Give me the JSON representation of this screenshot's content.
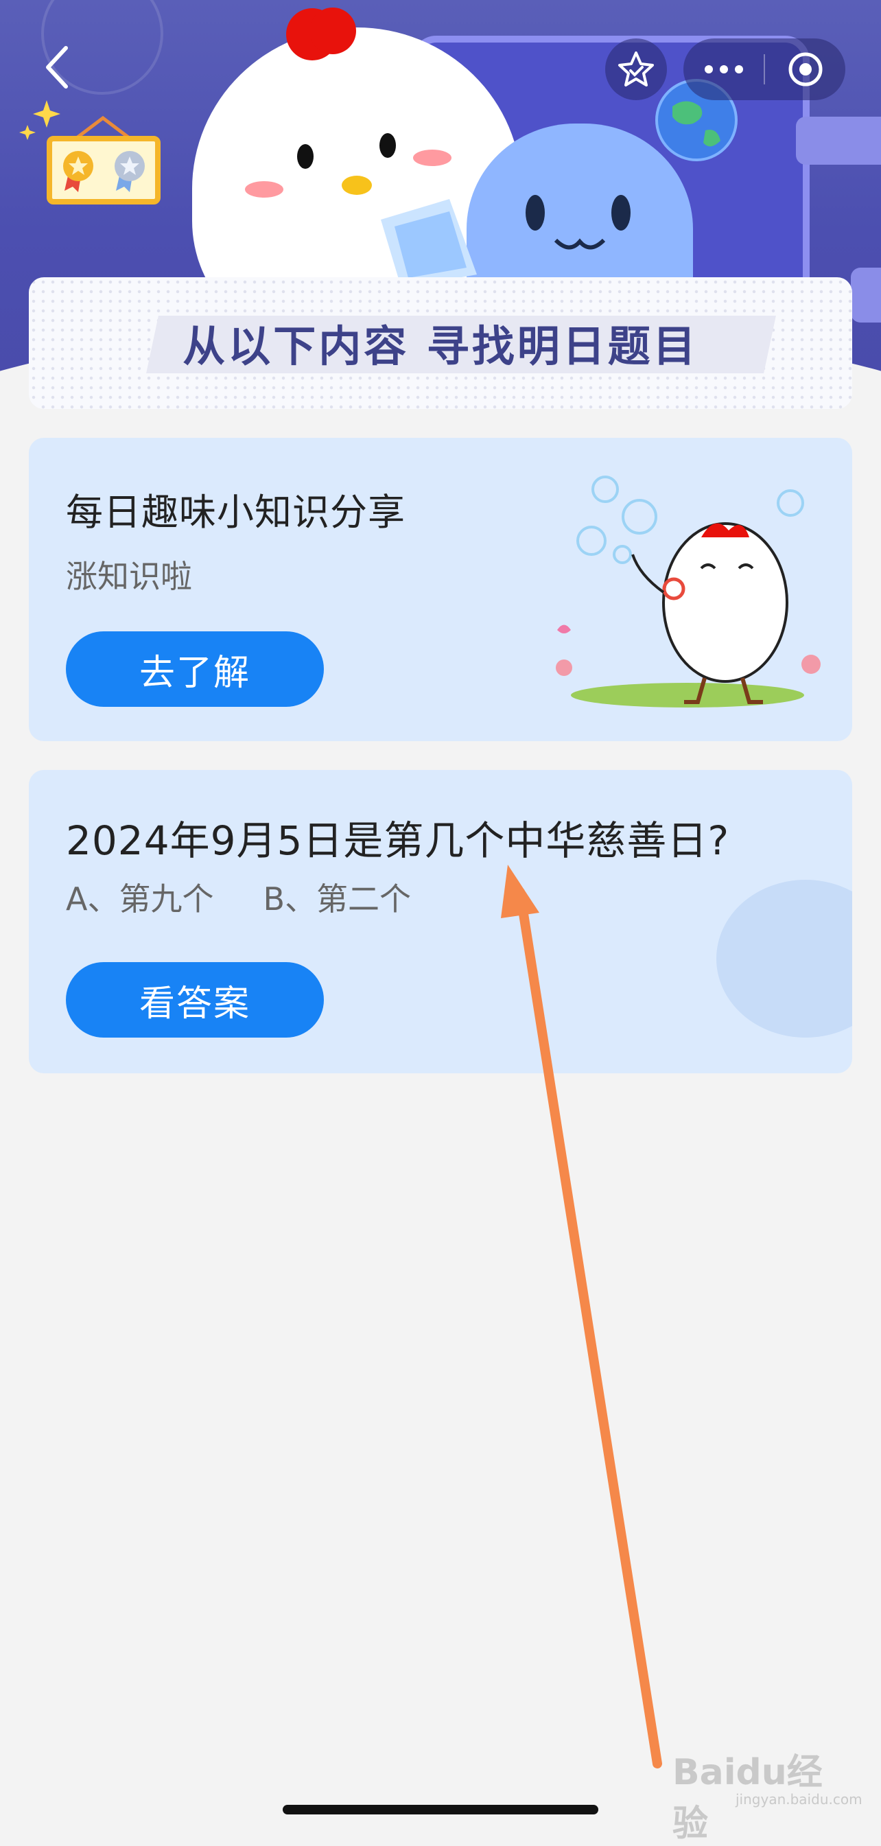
{
  "banner": {
    "title": "从以下内容  寻找明日题目"
  },
  "card_knowledge": {
    "title": "每日趣味小知识分享",
    "subtitle": "涨知识啦",
    "button_label": "去了解"
  },
  "card_question": {
    "question": "2024年9月5日是第几个中华慈善日?",
    "option_a": "A、第九个",
    "option_b": "B、第二个",
    "button_label": "看答案"
  },
  "watermark": {
    "brand": "Baidu经验",
    "domain": "jingyan.baidu.com"
  },
  "colors": {
    "hero_bg": "#4c4fb0",
    "card_bg": "#dbeafd",
    "button_blue": "#1883f5",
    "arrow_orange": "#f5884a"
  },
  "icons": {
    "back": "chevron-left-icon",
    "favorite": "star-icon",
    "more": "more-dots-icon",
    "close": "target-circle-icon"
  }
}
